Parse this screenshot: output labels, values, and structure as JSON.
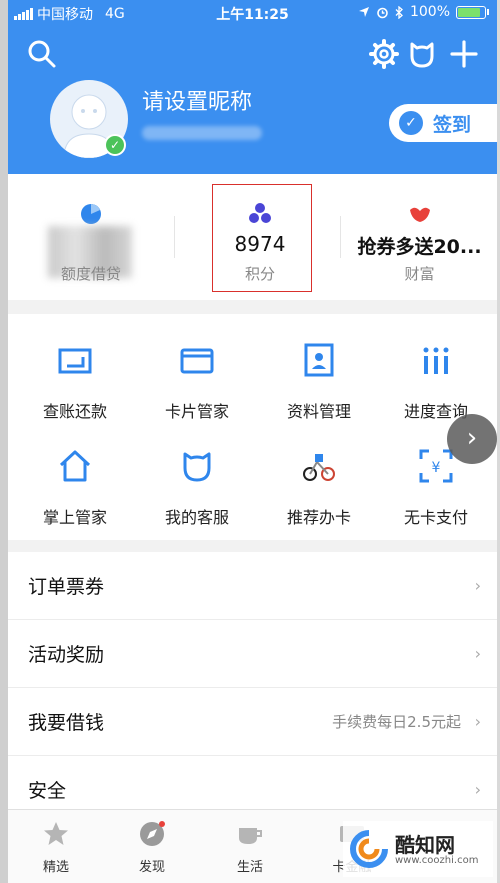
{
  "status_bar": {
    "carrier": "中国移动",
    "network": "4G",
    "time": "上午11:25",
    "battery": "100%"
  },
  "header": {
    "nickname": "请设置昵称",
    "checkin_label": "签到"
  },
  "stats": [
    {
      "value": "",
      "label": "额度借贷",
      "color": "#2f86ec"
    },
    {
      "value": "8974",
      "label": "积分",
      "color": "#4a45d6"
    },
    {
      "value": "抢券多送20...",
      "label": "财富",
      "color": "#e8413a"
    }
  ],
  "grid": [
    {
      "label": "查账还款",
      "icon": "bill-icon"
    },
    {
      "label": "卡片管家",
      "icon": "card-icon"
    },
    {
      "label": "资料管理",
      "icon": "profile-icon"
    },
    {
      "label": "进度查询",
      "icon": "progress-icon"
    },
    {
      "label": "掌上管家",
      "icon": "home-icon"
    },
    {
      "label": "我的客服",
      "icon": "service-icon"
    },
    {
      "label": "推荐办卡",
      "icon": "recommend-icon"
    },
    {
      "label": "无卡支付",
      "icon": "scan-pay-icon"
    }
  ],
  "list": [
    {
      "title": "订单票券",
      "hint": ""
    },
    {
      "title": "活动奖励",
      "hint": ""
    },
    {
      "title": "我要借钱",
      "hint": "手续费每日2.5元起"
    },
    {
      "title": "安全",
      "hint": ""
    }
  ],
  "tabs": [
    {
      "label": "精选",
      "icon": "star-icon"
    },
    {
      "label": "发现",
      "icon": "compass-icon"
    },
    {
      "label": "生活",
      "icon": "cup-icon"
    },
    {
      "label": "卡金融",
      "icon": "card-tab-icon"
    }
  ],
  "watermark": {
    "title": "酷知网",
    "url": "www.coozhi.com"
  },
  "colors": {
    "primary": "#3b8ff0",
    "highlight": "#d9302c"
  }
}
